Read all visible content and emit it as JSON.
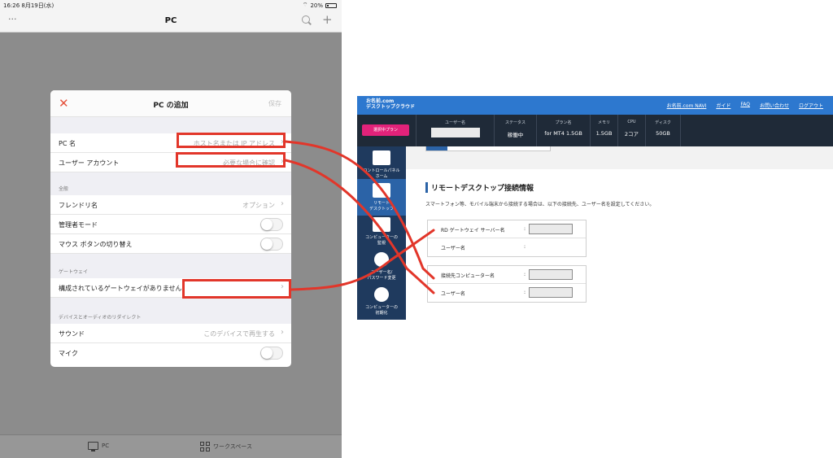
{
  "ipad": {
    "status": {
      "time": "16:26  8月19日(水)",
      "battery": "20%"
    },
    "nav": {
      "title": "PC",
      "more": "···",
      "plus": "+"
    },
    "tabs": {
      "pc": "PC",
      "workspace": "ワークスペース"
    },
    "modal": {
      "title": "PC の追加",
      "close": "✕",
      "save": "保存",
      "section_general": "全般",
      "section_gateway": "ゲートウェイ",
      "section_redirect": "デバイスとオーディオのリダイレクト",
      "pc_name": {
        "label": "PC 名",
        "value": "ホスト名または IP アドレス"
      },
      "user_account": {
        "label": "ユーザー アカウント",
        "value": "必要な場合に確認"
      },
      "friendly_name": {
        "label": "フレンドリ名",
        "value": "オプション"
      },
      "admin_mode": {
        "label": "管理者モード"
      },
      "swap_mouse": {
        "label": "マウス ボタンの切り替え"
      },
      "gateway": {
        "label": "構成されているゲートウェイがありません"
      },
      "sound": {
        "label": "サウンド",
        "value": "このデバイスで再生する"
      },
      "mic": {
        "label": "マイク"
      },
      "chevron": "›"
    }
  },
  "web": {
    "brand_line1": "お名前.com",
    "brand_line2": "デスクトップクラウド",
    "nav": [
      "お名前.com NAVI",
      "ガイド",
      "FAQ",
      "お問い合わせ",
      "ログアウト"
    ],
    "plan_button": "選択中プラン",
    "info": {
      "username_h": "ユーザー名",
      "status_h": "ステータス",
      "status_v": "稼働中",
      "plan_h": "プラン名",
      "plan_v": "for MT4 1.5GB",
      "memory_h": "メモリ",
      "memory_v": "1.5GB",
      "cpu_h": "CPU",
      "cpu_v": "2コア",
      "disk_h": "ディスク",
      "disk_v": "50GB"
    },
    "sidebar": [
      {
        "label1": "コントロールパネル",
        "label2": "ホーム"
      },
      {
        "label1": "リモート",
        "label2": "デスクトップ"
      },
      {
        "label1": "コンピューターの",
        "label2": "監視"
      },
      {
        "label1": "ユーザー名/",
        "label2": "パスワード変更"
      },
      {
        "label1": "コンピューターの",
        "label2": "初期化"
      }
    ],
    "section_title": "リモートデスクトップ接続情報",
    "section_desc": "スマートフォン等、モバイル端末から接続する場合は、以下の接続先、ユーザー名を設定してください。",
    "form1": {
      "gateway_label": "RD ゲートウェイ サーバー名",
      "user_label": "ユーザー名"
    },
    "form2": {
      "computer_label": "接続先コンピューター名",
      "user_label": "ユーザー名"
    },
    "colon": ":"
  },
  "colors": {
    "highlight": "#e2362a",
    "web_topbar": "#2d78cf",
    "web_sidebar": "#1f3a5e",
    "close_icon": "#e5533d"
  }
}
